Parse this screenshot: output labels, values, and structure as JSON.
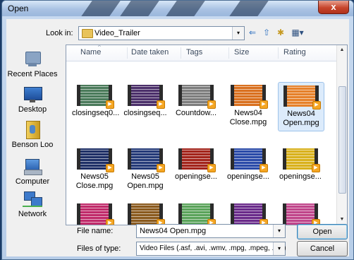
{
  "window": {
    "title": "Open",
    "close_glyph": "x"
  },
  "look_in": {
    "label": "Look in:",
    "value": "Video_Trailer",
    "dropdown_glyph": "▾"
  },
  "toolbar": {
    "back_glyph": "⇐",
    "up_glyph": "⇧",
    "new_folder_glyph": "✱",
    "views_glyph": "▦▾"
  },
  "places": [
    {
      "label": "Recent Places",
      "icon": "recent-places-icon"
    },
    {
      "label": "Desktop",
      "icon": "desktop-icon"
    },
    {
      "label": "Benson Loo",
      "icon": "user-folder-icon"
    },
    {
      "label": "Computer",
      "icon": "computer-icon"
    },
    {
      "label": "Network",
      "icon": "network-icon"
    }
  ],
  "columns": [
    "Name",
    "Date taken",
    "Tags",
    "Size",
    "Rating"
  ],
  "files": [
    {
      "name": "closingseq0...",
      "thumb": "#4a7a5a"
    },
    {
      "name": "closingseq...",
      "thumb": "#4b2f6a"
    },
    {
      "name": "Countdow...",
      "thumb": "#7d7d7d"
    },
    {
      "name": "News04 Close.mpg",
      "thumb": "#d9701f"
    },
    {
      "name": "News04 Open.mpg",
      "thumb": "#e6812a",
      "selected": true
    },
    {
      "name": "News05 Close.mpg",
      "thumb": "#1e2f66"
    },
    {
      "name": "News05 Open.mpg",
      "thumb": "#243a78"
    },
    {
      "name": "openingse...",
      "thumb": "#a3241b"
    },
    {
      "name": "openingse...",
      "thumb": "#2a4aa8"
    },
    {
      "name": "openingse...",
      "thumb": "#d9b11c"
    },
    {
      "name": "",
      "thumb": "#c02a6a"
    },
    {
      "name": "",
      "thumb": "#8a5a1e"
    },
    {
      "name": "",
      "thumb": "#5aa35a"
    },
    {
      "name": "",
      "thumb": "#6a2a8a"
    },
    {
      "name": "",
      "thumb": "#c0458a"
    }
  ],
  "file_name": {
    "label": "File name:",
    "value": "News04 Open.mpg"
  },
  "file_type": {
    "label": "Files of type:",
    "value": "Video Files (.asf, .avi, .wmv, .mpg, .mpeg, .dat)"
  },
  "buttons": {
    "open": "Open",
    "cancel": "Cancel"
  },
  "colors": {
    "titlebar": "#a9c2e3",
    "selection": "#dcebfb",
    "close": "#c7452c"
  }
}
